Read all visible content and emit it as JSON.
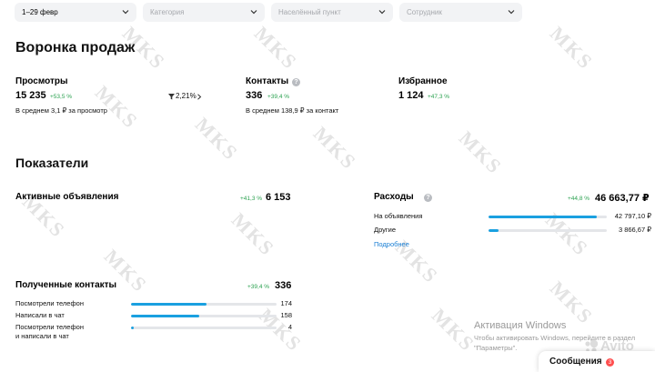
{
  "filters": [
    {
      "text": "1–29 февр",
      "placeholder": false
    },
    {
      "text": "Категория",
      "placeholder": true
    },
    {
      "text": "Населённый пункт",
      "placeholder": true
    },
    {
      "text": "Сотрудник",
      "placeholder": true
    }
  ],
  "funnel": {
    "title": "Воронка продаж",
    "views": {
      "label": "Просмотры",
      "value": "15 235",
      "delta": "+53,5 %",
      "sub": "В среднем 3,1 ₽ за просмотр"
    },
    "conversion": {
      "value": "2,21%"
    },
    "contacts": {
      "label": "Контакты",
      "value": "336",
      "delta": "+39,4 %",
      "sub": "В среднем 138,9 ₽ за контакт"
    },
    "favorites": {
      "label": "Избранное",
      "value": "1 124",
      "delta": "+47,3 %"
    }
  },
  "indicators": {
    "title": "Показатели",
    "active": {
      "label": "Активные объявления",
      "delta": "+41,3 %",
      "value": "6 153"
    },
    "expenses": {
      "label": "Расходы",
      "delta": "+44,8 %",
      "value": "46 663,77 ₽",
      "rows": [
        {
          "label": "На объявления",
          "value": "42 797,10 ₽",
          "fraction": 0.917
        },
        {
          "label": "Другие",
          "value": "3 866,67 ₽",
          "fraction": 0.083
        }
      ],
      "more": "Подробнее"
    },
    "received": {
      "label": "Полученные контакты",
      "delta": "+39,4 %",
      "value": "336",
      "rows": [
        {
          "label": "Посмотрели телефон",
          "value": "174",
          "fraction": 0.518
        },
        {
          "label": "Написали в чат",
          "value": "158",
          "fraction": 0.47
        },
        {
          "label": "Посмотрели телефон\nи написали в чат",
          "value": "4",
          "fraction": 0.012
        }
      ]
    }
  },
  "watermark": "MKS",
  "windows": {
    "title": "Активация Windows",
    "line1": "Чтобы активировать Windows, перейдите в раздел",
    "line2": "\"Параметры\"."
  },
  "brand": "Avito",
  "messages": {
    "label": "Сообщения",
    "count": "3"
  },
  "colors": {
    "accent": "#1aa0e0",
    "positive": "#2aa14f",
    "link": "#1a7fd4"
  }
}
